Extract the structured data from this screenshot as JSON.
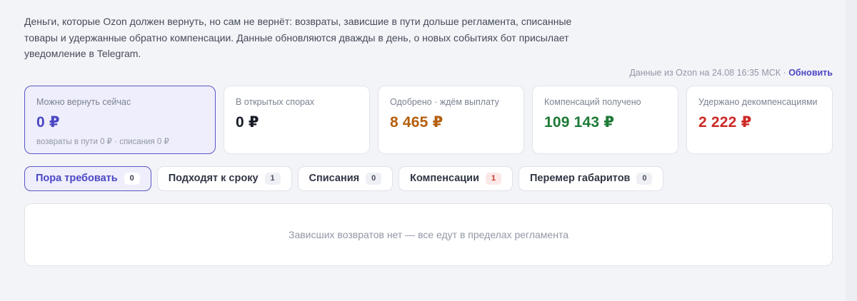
{
  "intro": "Деньги, которые Ozon должен вернуть, но сам не вернёт: возвраты, зависшие в пути дольше регламента, списанные товары и удержанные обратно компенсации. Данные обновляются дважды в день, о новых событиях бот присылает уведомление в Telegram.",
  "meta": {
    "data_source": "Данные из Ozon на 24.08 16:35 МСК",
    "separator": " · ",
    "refresh_label": "Обновить"
  },
  "cards": [
    {
      "label": "Можно вернуть сейчас",
      "value": "0 ₽",
      "sub": "возвраты в пути 0 ₽ · списания 0 ₽",
      "color": "#4b47c4"
    },
    {
      "label": "В открытых спорах",
      "value": "0 ₽",
      "color": "#171b26"
    },
    {
      "label": "Одобрено · ждём выплату",
      "value": "8 465 ₽",
      "color": "#b45f0f"
    },
    {
      "label": "Компенсаций получено",
      "value": "109 143 ₽",
      "color": "#1e7a36"
    },
    {
      "label": "Удержано декомпенсациями",
      "value": "2 222 ₽",
      "color": "#cc2a26"
    }
  ],
  "tabs": [
    {
      "label": "Пора требовать",
      "count": "0"
    },
    {
      "label": "Подходят к сроку",
      "count": "1"
    },
    {
      "label": "Списания",
      "count": "0"
    },
    {
      "label": "Компенсации",
      "count": "1"
    },
    {
      "label": "Перемер габаритов",
      "count": "0"
    }
  ],
  "empty_state": "Зависших возвратов нет — все едут в пределах регламента"
}
